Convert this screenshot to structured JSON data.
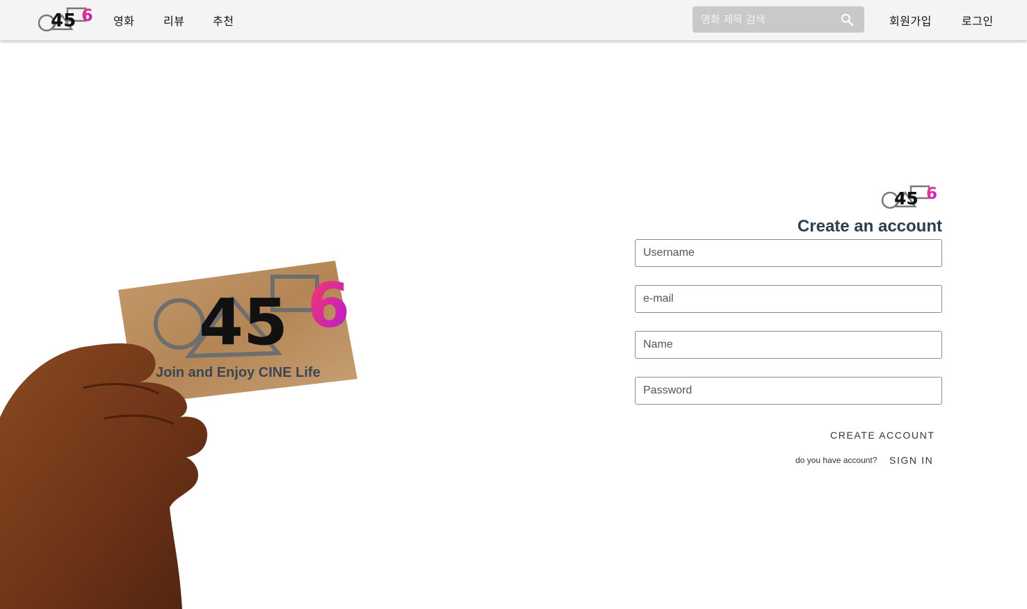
{
  "brand": {
    "logo_text": "456"
  },
  "nav": {
    "links": [
      {
        "label": "영화"
      },
      {
        "label": "리뷰"
      },
      {
        "label": "추천"
      }
    ],
    "search": {
      "placeholder": "영화 제목 검색",
      "icon": "search-icon"
    },
    "signup_label": "회원가입",
    "login_label": "로그인"
  },
  "promo": {
    "tagline": "Join and Enjoy CINE Life"
  },
  "form": {
    "title": "Create an account",
    "fields": {
      "username": {
        "placeholder": "Username"
      },
      "email": {
        "placeholder": "e-mail"
      },
      "name": {
        "placeholder": "Name"
      },
      "password": {
        "placeholder": "Password"
      }
    },
    "create_button": "CREATE ACCOUNT",
    "signin_hint": "do you have account?",
    "signin_button": "SIGN IN"
  },
  "colors": {
    "accent_pink": "#e8317c",
    "accent_purple": "#b019e0",
    "header_bg": "#f4f4f4",
    "title_color": "#2c3e50"
  }
}
